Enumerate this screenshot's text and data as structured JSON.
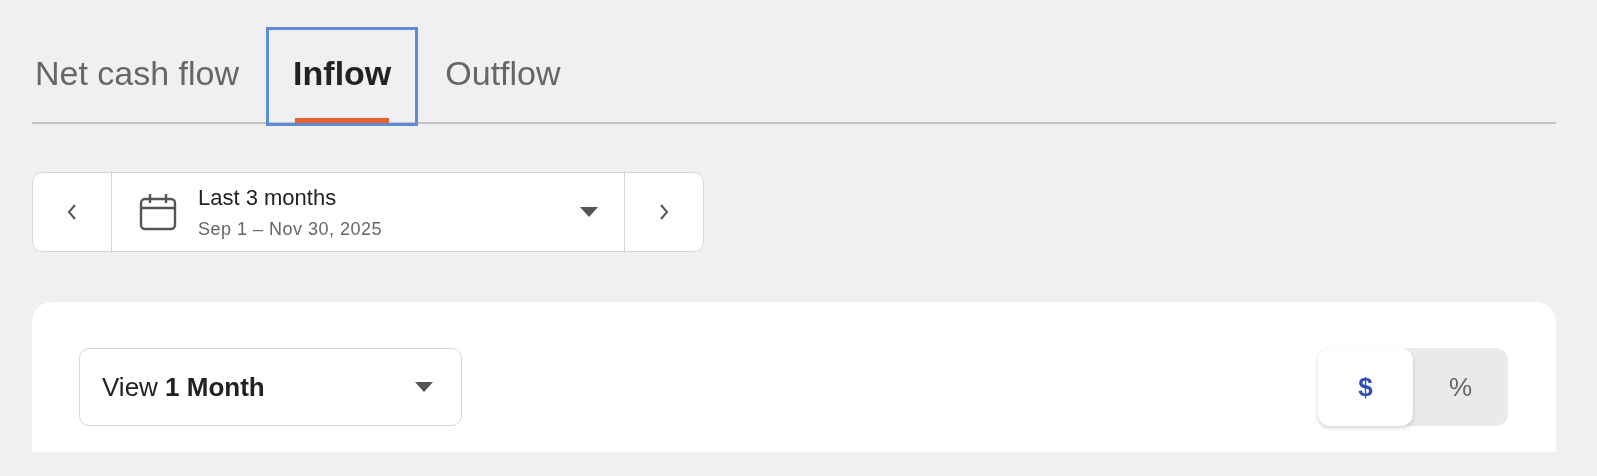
{
  "tabs": [
    {
      "label": "Net cash flow",
      "selected": false,
      "focused": false
    },
    {
      "label": "Inflow",
      "selected": true,
      "focused": true
    },
    {
      "label": "Outflow",
      "selected": false,
      "focused": false
    }
  ],
  "date_range": {
    "label": "Last 3 months",
    "dates": "Sep 1 – Nov 30, 2025"
  },
  "view_select": {
    "prefix": "View",
    "value": "1 Month"
  },
  "unit_toggle": [
    {
      "label": "$",
      "selected": true
    },
    {
      "label": "%",
      "selected": false
    }
  ]
}
